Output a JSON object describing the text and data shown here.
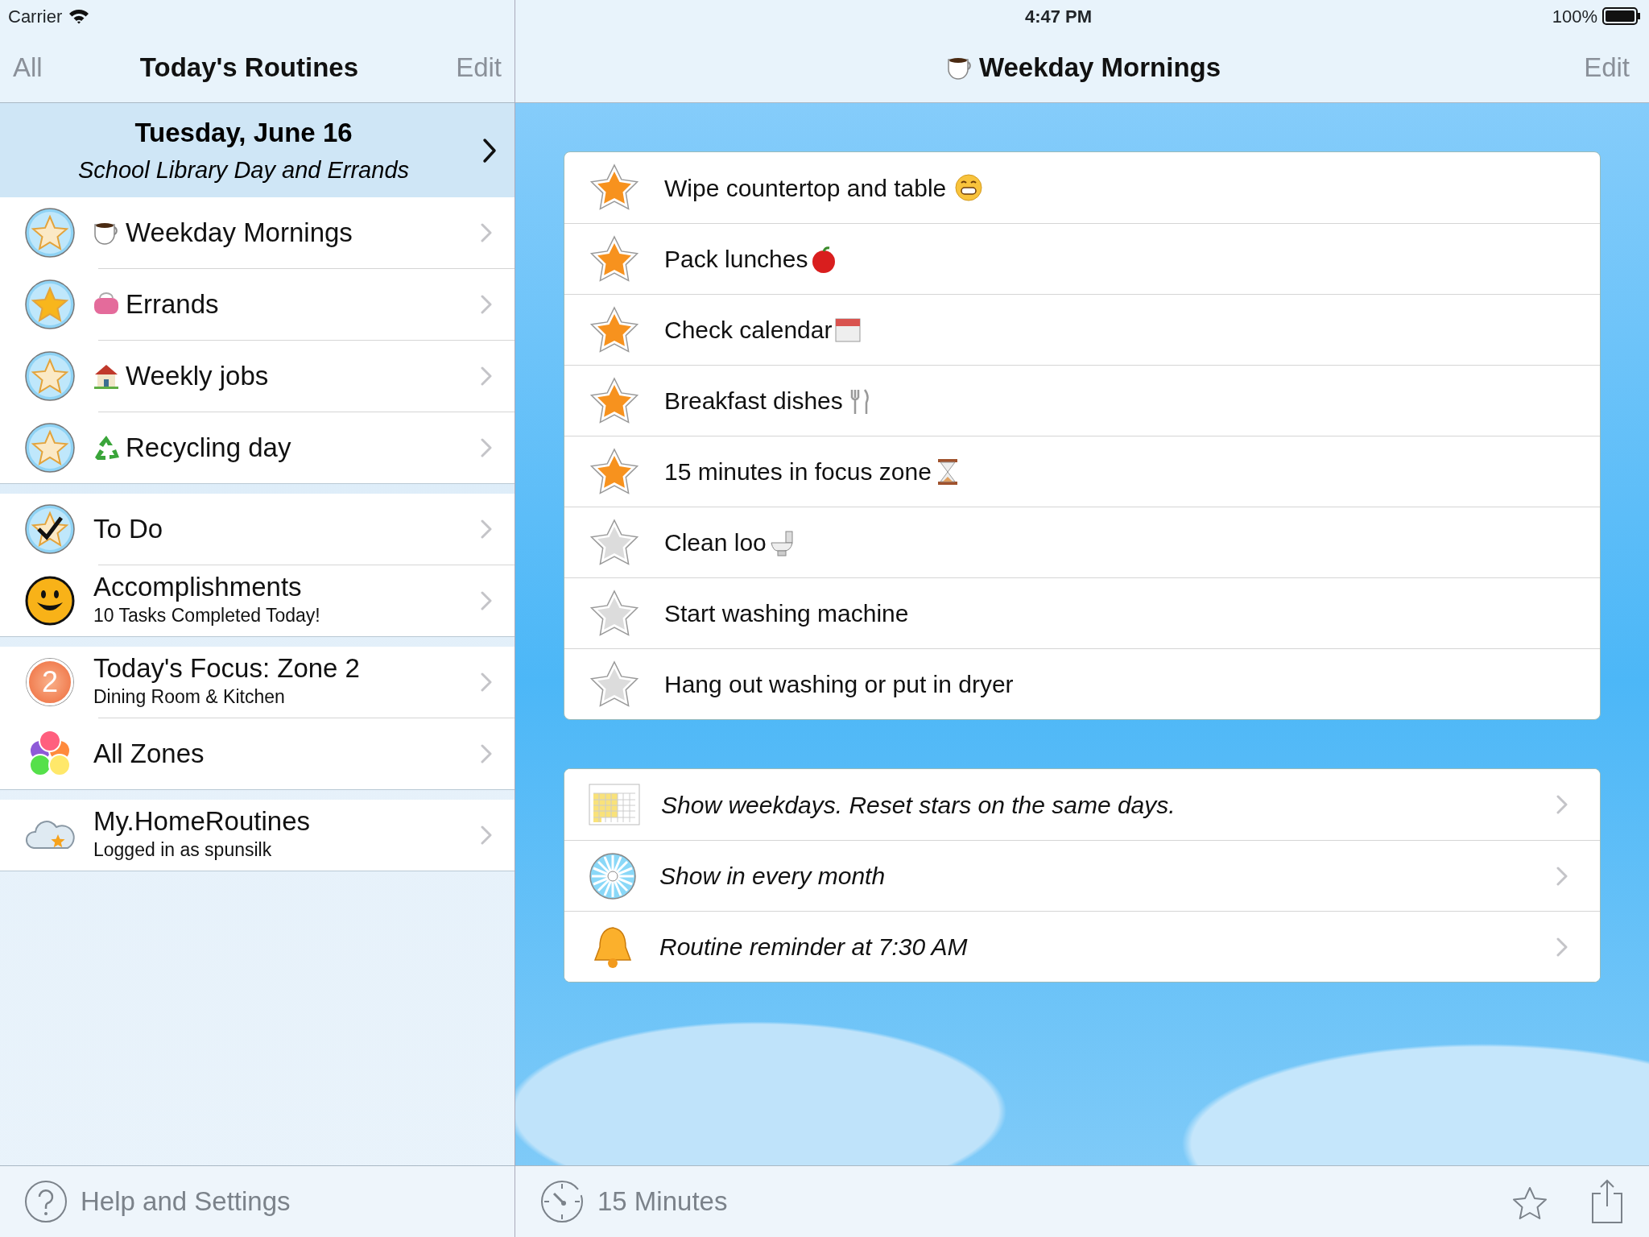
{
  "status_bar": {
    "carrier": "Carrier",
    "time": "4:47 PM",
    "battery": "100%"
  },
  "sidebar": {
    "nav": {
      "left": "All",
      "title": "Today's Routines",
      "right": "Edit"
    },
    "date_header": {
      "title": "Tuesday, June 16",
      "subtitle": "School Library Day and Errands"
    },
    "sections": [
      {
        "items": [
          {
            "kind": "routine",
            "title": "Weekday Mornings",
            "complete": false
          },
          {
            "kind": "routine",
            "title": "Errands",
            "complete": true
          },
          {
            "kind": "routine",
            "title": "Weekly jobs",
            "complete": false
          },
          {
            "kind": "routine",
            "title": "Recycling day",
            "complete": false
          }
        ]
      },
      {
        "items": [
          {
            "kind": "todo",
            "title": "To Do"
          },
          {
            "kind": "accomplishments",
            "title": "Accomplishments",
            "subtitle": "10 Tasks Completed Today!"
          }
        ]
      },
      {
        "items": [
          {
            "kind": "zone",
            "title": "Today's Focus: Zone 2",
            "subtitle": "Dining Room & Kitchen",
            "badge": "2"
          },
          {
            "kind": "all_zones",
            "title": "All Zones"
          }
        ]
      },
      {
        "items": [
          {
            "kind": "account",
            "title": "My.HomeRoutines",
            "subtitle": "Logged in as spunsilk"
          }
        ]
      }
    ],
    "toolbar": {
      "label": "Help and Settings"
    }
  },
  "detail": {
    "nav": {
      "title": "Weekday Mornings",
      "right": "Edit"
    },
    "tasks": [
      {
        "text": "Wipe countertop and table",
        "done": true
      },
      {
        "text": "Pack lunches",
        "done": true
      },
      {
        "text": "Check calendar",
        "done": true
      },
      {
        "text": "Breakfast dishes",
        "done": true
      },
      {
        "text": "15 minutes in focus zone",
        "done": true
      },
      {
        "text": "Clean loo",
        "done": false
      },
      {
        "text": "Start washing machine",
        "done": false
      },
      {
        "text": "Hang out washing or put in dryer",
        "done": false
      }
    ],
    "settings": [
      {
        "text": "Show weekdays. Reset stars on the same days."
      },
      {
        "text": "Show in every month"
      },
      {
        "text": "Routine reminder at 7:30 AM"
      }
    ],
    "toolbar": {
      "label": "15 Minutes"
    }
  }
}
